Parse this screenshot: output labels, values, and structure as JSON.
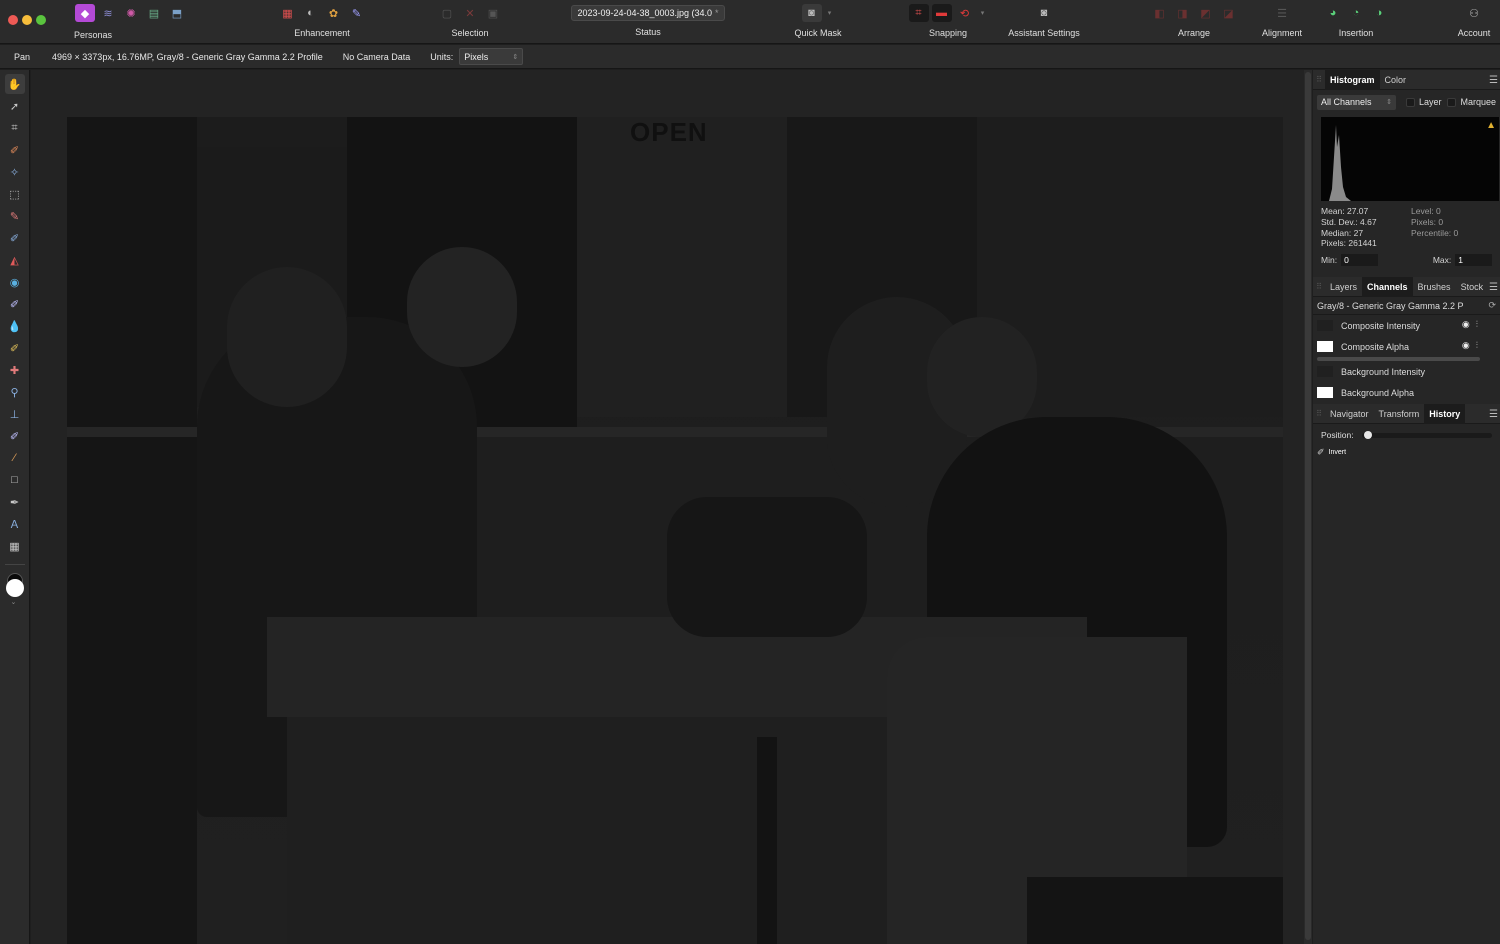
{
  "toolbar": {
    "personas_label": "Personas",
    "enhancement_label": "Enhancement",
    "selection_label": "Selection",
    "document_tab": "2023-09-24-04-38_0003.jpg (34.0",
    "document_tab_mark": "*",
    "status_label": "Status",
    "quick_mask_label": "Quick Mask",
    "snapping_label": "Snapping",
    "assistant_label": "Assistant Settings",
    "arrange_label": "Arrange",
    "alignment_label": "Alignment",
    "insertion_label": "Insertion",
    "account_label": "Account"
  },
  "context": {
    "tool_name": "Pan",
    "image_info": "4969 × 3373px, 16.76MP, Gray/8 - Generic Gray Gamma 2.2 Profile",
    "camera": "No Camera Data",
    "units_label": "Units:",
    "units_value": "Pixels"
  },
  "histogram": {
    "tabs": [
      "Histogram",
      "Color"
    ],
    "channel": "All Channels",
    "layer_label": "Layer",
    "marquee_label": "Marquee",
    "mean": "Mean: 27.07",
    "std_dev": "Std. Dev.: 4.67",
    "median": "Median: 27",
    "pixels": "Pixels: 261441",
    "level": "Level: 0",
    "pixels_sel": "Pixels: 0",
    "percentile": "Percentile: 0",
    "min_label": "Min:",
    "min_value": "0",
    "max_label": "Max:",
    "max_value": "1"
  },
  "channels": {
    "tabs": [
      "Layers",
      "Channels",
      "Brushes",
      "Stock"
    ],
    "profile": "Gray/8 - Generic Gray Gamma 2.2 P",
    "rows": [
      "Composite Intensity",
      "Composite Alpha",
      "Background Intensity",
      "Background Alpha"
    ]
  },
  "navigator": {
    "tabs": [
      "Navigator",
      "Transform",
      "History"
    ],
    "position_label": "Position:",
    "history_items": [
      "Invert"
    ]
  },
  "canvas": {
    "sign_text": "OPEN"
  },
  "colors": {
    "accent_persona": "#b44ad6",
    "traffic_close": "#ee5a55",
    "traffic_min": "#f6bd3b",
    "traffic_max": "#5ac43e"
  }
}
